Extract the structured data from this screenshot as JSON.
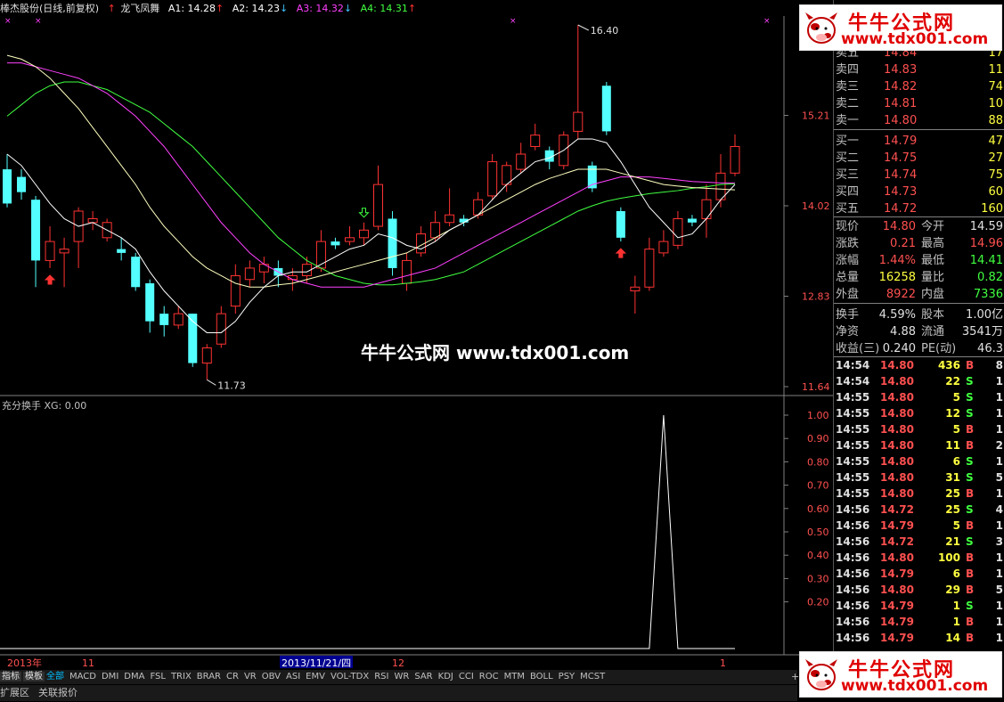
{
  "header": {
    "stock": "棒杰股份(日线,前复权)",
    "indicator": "龙飞凤舞",
    "a1": "A1: 14.28",
    "a2": "A2: 14.23",
    "a3": "A3: 14.32",
    "a4": "A4: 14.31",
    "colors": {
      "a1": "#ffffff",
      "a2": "#ffffff",
      "a3": "#ff40ff",
      "a4": "#40ff40"
    }
  },
  "main_chart": {
    "price_labels": [
      "15.21",
      "14.02",
      "12.83",
      "11.64"
    ],
    "high_label": "16.40",
    "low_label": "11.73"
  },
  "sub_chart": {
    "title": "充分换手 XG: 0.00",
    "axis_labels": [
      "1.00",
      "0.90",
      "0.80",
      "0.70",
      "0.60",
      "0.50",
      "0.40",
      "0.30",
      "0.20"
    ]
  },
  "x_axis": {
    "labels": [
      "2013年",
      "11",
      "2013/11/21/四",
      "12",
      "1"
    ]
  },
  "watermark": "牛牛公式网 www.tdx001.com",
  "logo": {
    "title": "牛牛公式网",
    "url": "www.tdx001.com"
  },
  "orderbook": {
    "sell": [
      {
        "label": "卖五",
        "price": "14.84",
        "vol": "17"
      },
      {
        "label": "卖四",
        "price": "14.83",
        "vol": "11"
      },
      {
        "label": "卖三",
        "price": "14.82",
        "vol": "74"
      },
      {
        "label": "卖二",
        "price": "14.81",
        "vol": "10"
      },
      {
        "label": "卖一",
        "price": "14.80",
        "vol": "88"
      }
    ],
    "buy": [
      {
        "label": "买一",
        "price": "14.79",
        "vol": "47"
      },
      {
        "label": "买二",
        "price": "14.75",
        "vol": "27"
      },
      {
        "label": "买三",
        "price": "14.74",
        "vol": "75"
      },
      {
        "label": "买四",
        "price": "14.73",
        "vol": "60"
      },
      {
        "label": "买五",
        "price": "14.72",
        "vol": "160"
      }
    ]
  },
  "quote": [
    {
      "l1": "现价",
      "v1": "14.80",
      "c1": "#ff5050",
      "l2": "今开",
      "v2": "14.59",
      "c2": "#e0e0e0"
    },
    {
      "l1": "涨跌",
      "v1": "0.21",
      "c1": "#ff5050",
      "l2": "最高",
      "v2": "14.96",
      "c2": "#ff5050"
    },
    {
      "l1": "涨幅",
      "v1": "1.44%",
      "c1": "#ff5050",
      "l2": "最低",
      "v2": "14.41",
      "c2": "#40ff40"
    },
    {
      "l1": "总量",
      "v1": "16258",
      "c1": "#ffff40",
      "l2": "量比",
      "v2": "0.82",
      "c2": "#40ff40"
    },
    {
      "l1": "外盘",
      "v1": "8922",
      "c1": "#ff5050",
      "l2": "内盘",
      "v2": "7336",
      "c2": "#40ff40"
    },
    {
      "l1": "换手",
      "v1": "4.59%",
      "c1": "#e0e0e0",
      "l2": "股本",
      "v2": "1.00亿",
      "c2": "#e0e0e0"
    },
    {
      "l1": "净资",
      "v1": "4.88",
      "c1": "#e0e0e0",
      "l2": "流通",
      "v2": "3541万",
      "c2": "#e0e0e0"
    },
    {
      "l1": "收益(三)",
      "v1": "0.240",
      "c1": "#e0e0e0",
      "l2": "PE(动)",
      "v2": "46.3",
      "c2": "#e0e0e0"
    }
  ],
  "ticks": [
    {
      "time": "14:54",
      "price": "14.80",
      "vol": "436",
      "bs": "B",
      "n": "8"
    },
    {
      "time": "14:54",
      "price": "14.80",
      "vol": "22",
      "bs": "S",
      "n": "1"
    },
    {
      "time": "14:55",
      "price": "14.80",
      "vol": "5",
      "bs": "S",
      "n": "1"
    },
    {
      "time": "14:55",
      "price": "14.80",
      "vol": "12",
      "bs": "S",
      "n": "1"
    },
    {
      "time": "14:55",
      "price": "14.80",
      "vol": "5",
      "bs": "B",
      "n": "1"
    },
    {
      "time": "14:55",
      "price": "14.80",
      "vol": "11",
      "bs": "B",
      "n": "2"
    },
    {
      "time": "14:55",
      "price": "14.80",
      "vol": "6",
      "bs": "S",
      "n": "1"
    },
    {
      "time": "14:55",
      "price": "14.80",
      "vol": "31",
      "bs": "S",
      "n": "5"
    },
    {
      "time": "14:55",
      "price": "14.80",
      "vol": "25",
      "bs": "B",
      "n": "1"
    },
    {
      "time": "14:56",
      "price": "14.72",
      "vol": "25",
      "bs": "S",
      "n": "4"
    },
    {
      "time": "14:56",
      "price": "14.79",
      "vol": "5",
      "bs": "B",
      "n": "1"
    },
    {
      "time": "14:56",
      "price": "14.72",
      "vol": "21",
      "bs": "S",
      "n": "3"
    },
    {
      "time": "14:56",
      "price": "14.80",
      "vol": "100",
      "bs": "B",
      "n": "1"
    },
    {
      "time": "14:56",
      "price": "14.79",
      "vol": "6",
      "bs": "B",
      "n": "1"
    },
    {
      "time": "14:56",
      "price": "14.80",
      "vol": "29",
      "bs": "B",
      "n": "5"
    },
    {
      "time": "14:56",
      "price": "14.79",
      "vol": "1",
      "bs": "S",
      "n": "1"
    },
    {
      "time": "14:56",
      "price": "14.79",
      "vol": "1",
      "bs": "B",
      "n": "1"
    },
    {
      "time": "14:56",
      "price": "14.79",
      "vol": "14",
      "bs": "B",
      "n": "1"
    }
  ],
  "tabs": [
    "指标",
    "模板",
    "全部",
    "MACD",
    "DMI",
    "DMA",
    "FSL",
    "TRIX",
    "BRAR",
    "CR",
    "VR",
    "OBV",
    "ASI",
    "EMV",
    "VOL-TDX",
    "RSI",
    "WR",
    "SAR",
    "KDJ",
    "CCI",
    "ROC",
    "MTM",
    "BOLL",
    "PSY",
    "MCST"
  ],
  "bottom_tabs": [
    "扩展区",
    "关联报价"
  ],
  "plus": "+",
  "chart_data": {
    "type": "candlestick",
    "candles": [
      {
        "o": 14.5,
        "c": 14.05,
        "h": 14.7,
        "l": 14.0
      },
      {
        "o": 14.4,
        "c": 14.2,
        "h": 14.5,
        "l": 14.1
      },
      {
        "o": 14.1,
        "c": 13.3,
        "h": 14.15,
        "l": 12.95
      },
      {
        "o": 13.3,
        "c": 13.55,
        "h": 13.75,
        "l": 13.2
      },
      {
        "o": 13.4,
        "c": 13.45,
        "h": 13.6,
        "l": 12.95
      },
      {
        "o": 13.55,
        "c": 13.95,
        "h": 14.0,
        "l": 13.2
      },
      {
        "o": 13.8,
        "c": 13.85,
        "h": 13.95,
        "l": 13.7
      },
      {
        "o": 13.6,
        "c": 13.8,
        "h": 13.85,
        "l": 13.55
      },
      {
        "o": 13.45,
        "c": 13.4,
        "h": 13.6,
        "l": 13.3
      },
      {
        "o": 13.35,
        "c": 12.95,
        "h": 13.4,
        "l": 12.9
      },
      {
        "o": 13.0,
        "c": 12.5,
        "h": 13.05,
        "l": 12.35
      },
      {
        "o": 12.6,
        "c": 12.45,
        "h": 12.7,
        "l": 12.3
      },
      {
        "o": 12.45,
        "c": 12.6,
        "h": 12.7,
        "l": 12.4
      },
      {
        "o": 12.6,
        "c": 11.95,
        "h": 12.6,
        "l": 11.9
      },
      {
        "o": 11.95,
        "c": 12.15,
        "h": 12.2,
        "l": 11.73
      },
      {
        "o": 12.2,
        "c": 12.6,
        "h": 12.7,
        "l": 12.15
      },
      {
        "o": 12.7,
        "c": 13.1,
        "h": 13.25,
        "l": 12.6
      },
      {
        "o": 13.05,
        "c": 13.2,
        "h": 13.3,
        "l": 12.95
      },
      {
        "o": 13.15,
        "c": 13.25,
        "h": 13.35,
        "l": 13.0
      },
      {
        "o": 13.2,
        "c": 13.1,
        "h": 13.3,
        "l": 12.95
      },
      {
        "o": 13.05,
        "c": 13.1,
        "h": 13.2,
        "l": 12.9
      },
      {
        "o": 13.1,
        "c": 13.25,
        "h": 13.35,
        "l": 13.0
      },
      {
        "o": 13.2,
        "c": 13.55,
        "h": 13.7,
        "l": 13.15
      },
      {
        "o": 13.55,
        "c": 13.5,
        "h": 13.6,
        "l": 13.45
      },
      {
        "o": 13.55,
        "c": 13.6,
        "h": 13.75,
        "l": 13.5
      },
      {
        "o": 13.6,
        "c": 13.7,
        "h": 13.8,
        "l": 13.5
      },
      {
        "o": 13.75,
        "c": 14.3,
        "h": 14.55,
        "l": 13.7
      },
      {
        "o": 13.85,
        "c": 13.2,
        "h": 13.95,
        "l": 13.1
      },
      {
        "o": 13.0,
        "c": 13.3,
        "h": 13.4,
        "l": 12.9
      },
      {
        "o": 13.4,
        "c": 13.65,
        "h": 13.75,
        "l": 13.35
      },
      {
        "o": 13.6,
        "c": 13.8,
        "h": 13.95,
        "l": 13.55
      },
      {
        "o": 13.8,
        "c": 13.9,
        "h": 14.25,
        "l": 13.75
      },
      {
        "o": 13.85,
        "c": 13.8,
        "h": 13.9,
        "l": 13.75
      },
      {
        "o": 13.9,
        "c": 14.1,
        "h": 14.2,
        "l": 13.85
      },
      {
        "o": 14.15,
        "c": 14.6,
        "h": 14.7,
        "l": 14.1
      },
      {
        "o": 14.3,
        "c": 14.55,
        "h": 14.6,
        "l": 14.2
      },
      {
        "o": 14.5,
        "c": 14.7,
        "h": 14.85,
        "l": 14.45
      },
      {
        "o": 14.8,
        "c": 14.95,
        "h": 15.1,
        "l": 14.75
      },
      {
        "o": 14.75,
        "c": 14.6,
        "h": 14.8,
        "l": 14.5
      },
      {
        "o": 14.55,
        "c": 14.95,
        "h": 15.0,
        "l": 14.5
      },
      {
        "o": 15.0,
        "c": 15.25,
        "h": 16.4,
        "l": 14.9
      },
      {
        "o": 14.55,
        "c": 14.25,
        "h": 14.6,
        "l": 14.2
      },
      {
        "o": 15.6,
        "c": 15.0,
        "h": 15.65,
        "l": 14.95
      },
      {
        "o": 13.95,
        "c": 13.6,
        "h": 14.0,
        "l": 13.55
      },
      {
        "o": 12.9,
        "c": 12.95,
        "h": 13.1,
        "l": 12.6
      },
      {
        "o": 12.95,
        "c": 13.45,
        "h": 13.6,
        "l": 12.9
      },
      {
        "o": 13.4,
        "c": 13.55,
        "h": 13.7,
        "l": 13.35
      },
      {
        "o": 13.5,
        "c": 13.85,
        "h": 13.95,
        "l": 13.45
      },
      {
        "o": 13.85,
        "c": 13.8,
        "h": 13.9,
        "l": 13.75
      },
      {
        "o": 13.85,
        "c": 14.1,
        "h": 14.3,
        "l": 13.6
      },
      {
        "o": 14.1,
        "c": 14.45,
        "h": 14.7,
        "l": 14.0
      },
      {
        "o": 14.45,
        "c": 14.8,
        "h": 14.96,
        "l": 14.41
      }
    ],
    "ma_a1": [
      14.7,
      14.55,
      14.3,
      14.05,
      13.85,
      13.75,
      13.8,
      13.7,
      13.6,
      13.45,
      13.15,
      12.9,
      12.7,
      12.5,
      12.35,
      12.35,
      12.5,
      12.75,
      12.95,
      13.1,
      13.15,
      13.15,
      13.25,
      13.35,
      13.45,
      13.5,
      13.65,
      13.6,
      13.5,
      13.45,
      13.55,
      13.7,
      13.8,
      13.9,
      14.1,
      14.3,
      14.45,
      14.6,
      14.65,
      14.75,
      14.9,
      14.9,
      14.85,
      14.6,
      14.3,
      14.0,
      13.8,
      13.6,
      13.65,
      13.85,
      14.1,
      14.3
    ],
    "ma_a3": [
      15.9,
      15.9,
      15.85,
      15.8,
      15.75,
      15.7,
      15.6,
      15.5,
      15.35,
      15.2,
      15.0,
      14.8,
      14.55,
      14.3,
      14.05,
      13.8,
      13.6,
      13.4,
      13.25,
      13.15,
      13.05,
      13.0,
      12.95,
      12.95,
      12.95,
      12.95,
      13.0,
      13.05,
      13.1,
      13.15,
      13.2,
      13.3,
      13.4,
      13.5,
      13.6,
      13.7,
      13.8,
      13.9,
      14.0,
      14.1,
      14.2,
      14.3,
      14.35,
      14.4,
      14.4,
      14.4,
      14.38,
      14.36,
      14.34,
      14.33,
      14.32,
      14.32
    ],
    "ma_a4": [
      15.2,
      15.35,
      15.5,
      15.6,
      15.65,
      15.65,
      15.6,
      15.55,
      15.45,
      15.35,
      15.25,
      15.1,
      14.95,
      14.8,
      14.6,
      14.4,
      14.2,
      14.0,
      13.8,
      13.6,
      13.45,
      13.3,
      13.2,
      13.1,
      13.05,
      13.0,
      12.98,
      12.98,
      13.0,
      13.02,
      13.05,
      13.1,
      13.15,
      13.25,
      13.35,
      13.45,
      13.55,
      13.65,
      13.75,
      13.85,
      13.95,
      14.02,
      14.08,
      14.12,
      14.15,
      14.18,
      14.2,
      14.22,
      14.25,
      14.27,
      14.3,
      14.31
    ],
    "ma_a2": [
      16.0,
      15.95,
      15.85,
      15.7,
      15.5,
      15.3,
      15.05,
      14.8,
      14.55,
      14.3,
      14.0,
      13.75,
      13.55,
      13.35,
      13.2,
      13.1,
      13.0,
      12.95,
      12.95,
      12.98,
      13.0,
      13.05,
      13.1,
      13.15,
      13.2,
      13.25,
      13.3,
      13.35,
      13.4,
      13.5,
      13.6,
      13.7,
      13.8,
      13.9,
      14.0,
      14.1,
      14.2,
      14.3,
      14.38,
      14.44,
      14.5,
      14.5,
      14.5,
      14.45,
      14.4,
      14.35,
      14.3,
      14.28,
      14.26,
      14.25,
      14.24,
      14.23
    ],
    "xg": [
      0,
      0,
      0,
      0,
      0,
      0,
      0,
      0,
      0,
      0,
      0,
      0,
      0,
      0,
      0,
      0,
      0,
      0,
      0,
      0,
      0,
      0,
      0,
      0,
      0,
      0,
      0,
      0,
      0,
      0,
      0,
      0,
      0,
      0,
      0,
      0,
      0,
      0,
      0,
      0,
      0,
      0,
      0,
      0,
      0,
      0,
      1,
      0,
      0,
      0,
      0,
      0
    ],
    "ylim": [
      11.64,
      16.4
    ]
  }
}
